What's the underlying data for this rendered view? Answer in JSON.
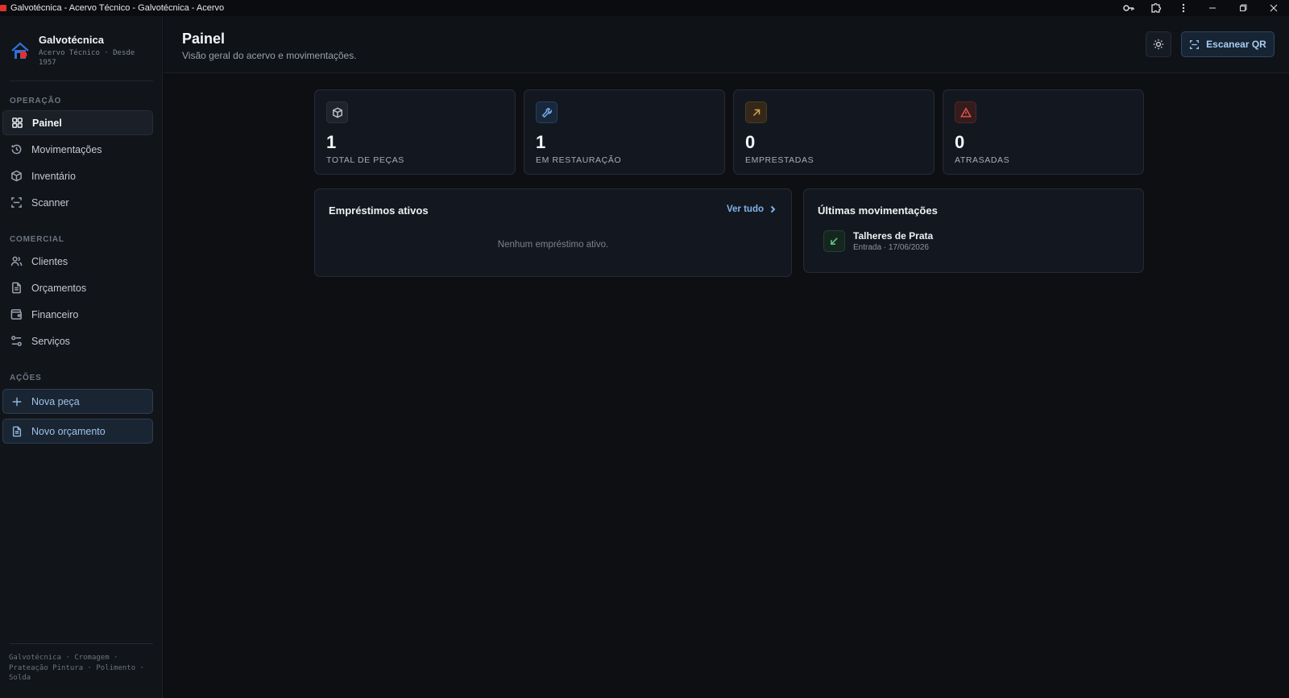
{
  "window": {
    "title": "Galvotécnica - Acervo Técnico - Galvotécnica - Acervo"
  },
  "brand": {
    "name": "Galvotécnica",
    "tagline": "Acervo Técnico · Desde 1957"
  },
  "sidebar": {
    "sections": {
      "operacao": "OPERAÇÃO",
      "comercial": "COMERCIAL",
      "acoes": "AÇÕES"
    },
    "operacao_items": [
      {
        "label": "Painel",
        "icon": "grid-icon",
        "active": true
      },
      {
        "label": "Movimentações",
        "icon": "history-icon"
      },
      {
        "label": "Inventário",
        "icon": "box-icon"
      },
      {
        "label": "Scanner",
        "icon": "scan-icon"
      }
    ],
    "comercial_items": [
      {
        "label": "Clientes",
        "icon": "users-icon"
      },
      {
        "label": "Orçamentos",
        "icon": "document-icon"
      },
      {
        "label": "Financeiro",
        "icon": "wallet-icon"
      },
      {
        "label": "Serviços",
        "icon": "sliders-icon"
      }
    ],
    "actions": [
      {
        "label": "Nova peça",
        "icon": "plus-icon"
      },
      {
        "label": "Novo orçamento",
        "icon": "document-icon"
      }
    ],
    "footer": "Galvotécnica · Cromagem · Prateação Pintura · Polimento · Solda"
  },
  "header": {
    "title": "Painel",
    "subtitle": "Visão geral do acervo e movimentações.",
    "qr_button": "Escanear QR"
  },
  "stats": [
    {
      "value": "1",
      "label": "TOTAL DE PEÇAS",
      "icon": "box-icon",
      "color": "#9aa2af"
    },
    {
      "value": "1",
      "label": "EM RESTAURAÇÃO",
      "icon": "wrench-icon",
      "color": "#6fa8e6"
    },
    {
      "value": "0",
      "label": "EMPRESTADAS",
      "icon": "arrow-up-right-icon",
      "color": "#e0a24a"
    },
    {
      "value": "0",
      "label": "ATRASADAS",
      "icon": "alert-triangle-icon",
      "color": "#e4544c"
    }
  ],
  "loans_panel": {
    "title": "Empréstimos ativos",
    "link": "Ver tudo",
    "empty": "Nenhum empréstimo ativo."
  },
  "movements_panel": {
    "title": "Últimas movimentações",
    "items": [
      {
        "name": "Talheres de Prata",
        "detail": "Entrada · 17/06/2026",
        "icon": "arrow-down-left-icon"
      }
    ]
  },
  "colors": {
    "background": "#0d0f13",
    "card": "#131820",
    "accent": "#7fb4ea"
  }
}
